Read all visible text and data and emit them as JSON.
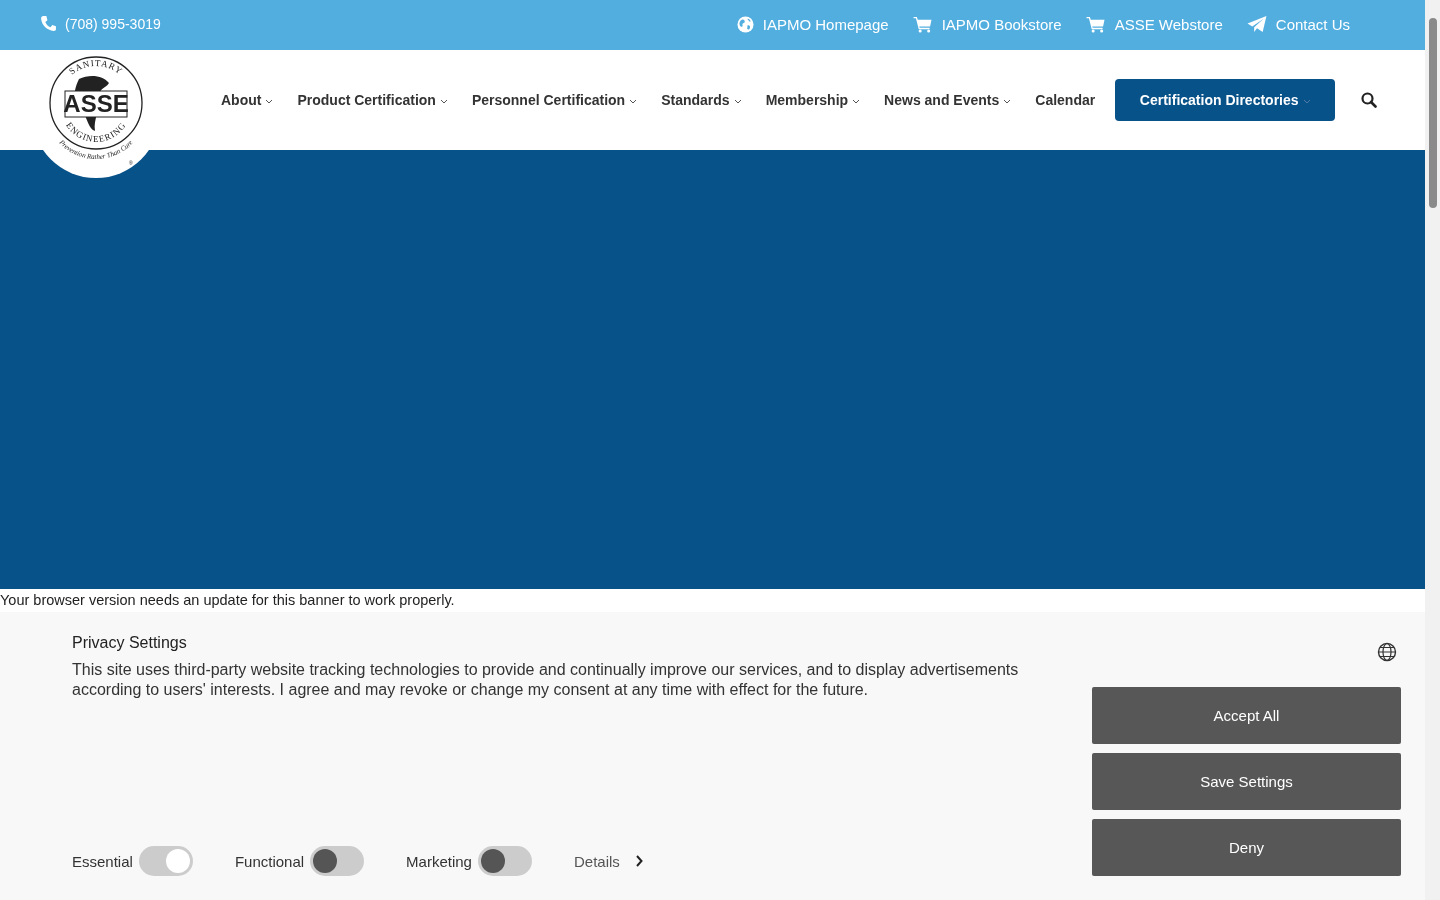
{
  "top_bar": {
    "phone": "(708) 995-3019",
    "links": [
      {
        "kind": "globe",
        "label": "IAPMO Homepage"
      },
      {
        "kind": "cart",
        "label": "IAPMO Bookstore"
      },
      {
        "kind": "cart",
        "label": "ASSE Webstore"
      },
      {
        "kind": "plane",
        "label": "Contact Us"
      }
    ]
  },
  "logo": {
    "top": "SANITARY",
    "center": "ASSE",
    "bottom": "ENGINEERING",
    "motto": "Prevention Rather Than Cure",
    "mark": "®"
  },
  "nav": {
    "items": [
      {
        "label": "About",
        "dropdown": true
      },
      {
        "label": "Product Certification",
        "dropdown": true
      },
      {
        "label": "Personnel Certification",
        "dropdown": true
      },
      {
        "label": "Standards",
        "dropdown": true
      },
      {
        "label": "Membership",
        "dropdown": true
      },
      {
        "label": "News and Events",
        "dropdown": true
      },
      {
        "label": "Calendar",
        "dropdown": false
      }
    ],
    "button": {
      "label": "Certification Directories",
      "dropdown": true
    }
  },
  "banner_notice": "Your browser version needs an update for this banner to work properly.",
  "privacy": {
    "title": "Privacy Settings",
    "text": "This site uses third-party website tracking technologies to provide and continually improve our services, and to display advertisements according to users' interests. I agree and may revoke or change my consent at any time with effect for the future.",
    "toggles": [
      {
        "label": "Essential",
        "on": true
      },
      {
        "label": "Functional",
        "on": false
      },
      {
        "label": "Marketing",
        "on": false
      }
    ],
    "details": "Details",
    "buttons": [
      "Accept All",
      "Save Settings",
      "Deny"
    ]
  }
}
